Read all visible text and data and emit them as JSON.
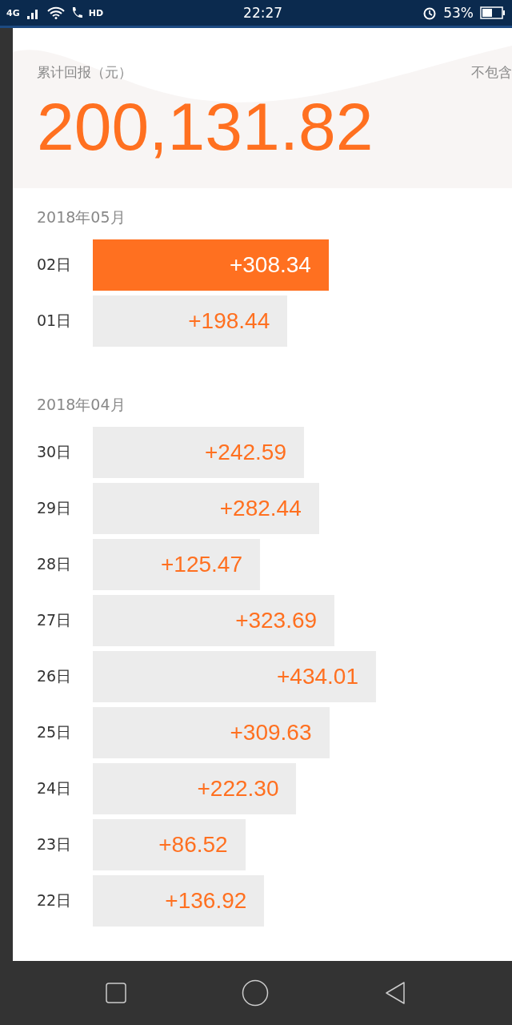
{
  "status_bar": {
    "network": "4G",
    "call": "HD",
    "time": "22:27",
    "battery": "53%"
  },
  "summary": {
    "label": "累计回报（元）",
    "note": "不包含",
    "total": "200,131.82"
  },
  "months": [
    {
      "title": "2018年05月",
      "days": [
        {
          "day": "02日",
          "amount": "+308.34",
          "selected": true
        },
        {
          "day": "01日",
          "amount": "+198.44",
          "selected": false
        }
      ]
    },
    {
      "title": "2018年04月",
      "days": [
        {
          "day": "30日",
          "amount": "+242.59",
          "selected": false
        },
        {
          "day": "29日",
          "amount": "+282.44",
          "selected": false
        },
        {
          "day": "28日",
          "amount": "+125.47",
          "selected": false
        },
        {
          "day": "27日",
          "amount": "+323.69",
          "selected": false
        },
        {
          "day": "26日",
          "amount": "+434.01",
          "selected": false
        },
        {
          "day": "25日",
          "amount": "+309.63",
          "selected": false
        },
        {
          "day": "24日",
          "amount": "+222.30",
          "selected": false
        },
        {
          "day": "23日",
          "amount": "+86.52",
          "selected": false
        },
        {
          "day": "22日",
          "amount": "+136.92",
          "selected": false
        }
      ]
    }
  ]
}
